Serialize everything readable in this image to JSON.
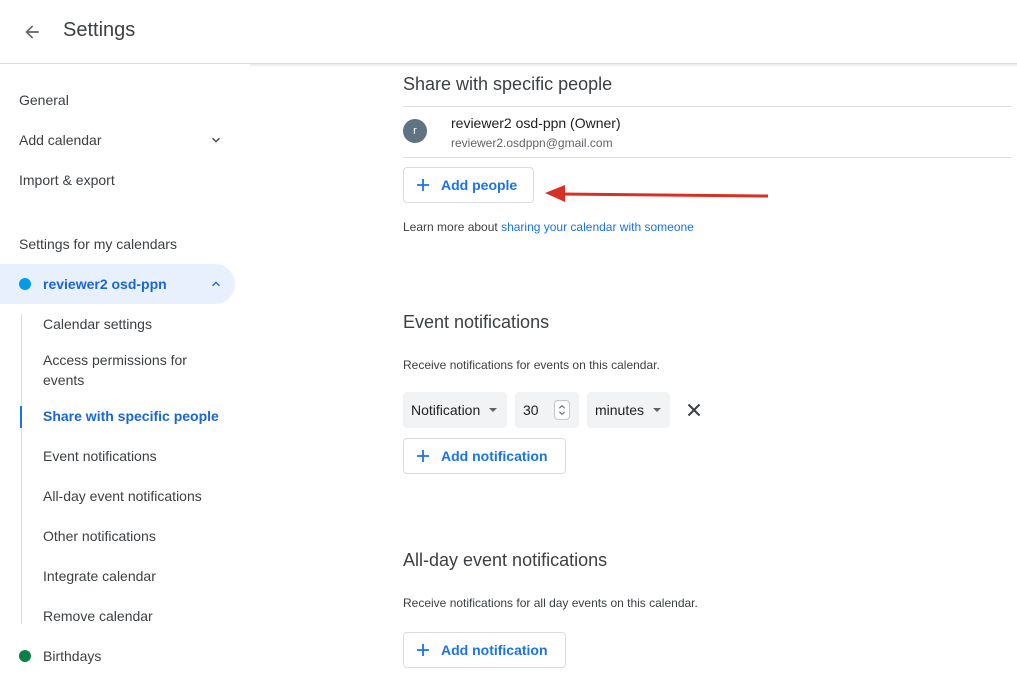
{
  "header": {
    "title": "Settings"
  },
  "sidebar": {
    "items": [
      {
        "label": "General"
      },
      {
        "label": "Add calendar"
      },
      {
        "label": "Import & export"
      }
    ],
    "section_heading": "Settings for my calendars",
    "calendar": {
      "label": "reviewer2 osd-ppn",
      "color": "#039be5",
      "subitems": [
        {
          "label": "Calendar settings"
        },
        {
          "label": "Access permissions for events"
        },
        {
          "label": "Share with specific people"
        },
        {
          "label": "Event notifications"
        },
        {
          "label": "All-day event notifications"
        },
        {
          "label": "Other notifications"
        },
        {
          "label": "Integrate calendar"
        },
        {
          "label": "Remove calendar"
        }
      ]
    },
    "birthdays": {
      "label": "Birthdays",
      "color": "#0b8043"
    }
  },
  "share": {
    "heading": "Share with specific people",
    "owner": {
      "avatar_letter": "r",
      "name": "reviewer2 osd-ppn (Owner)",
      "email": "reviewer2.osdppn@gmail.com"
    },
    "add_people_label": "Add people",
    "learn_more_prefix": "Learn more about ",
    "learn_more_link": "sharing your calendar with someone"
  },
  "event_notifications": {
    "heading": "Event notifications",
    "description": "Receive notifications for events on this calendar.",
    "type": "Notification",
    "amount": "30",
    "unit": "minutes",
    "add_label": "Add notification"
  },
  "allday_notifications": {
    "heading": "All-day event notifications",
    "description": "Receive notifications for all day events on this calendar.",
    "add_label": "Add notification"
  },
  "colors": {
    "accent": "#1a73e8",
    "annotation_arrow": "#d93025"
  }
}
